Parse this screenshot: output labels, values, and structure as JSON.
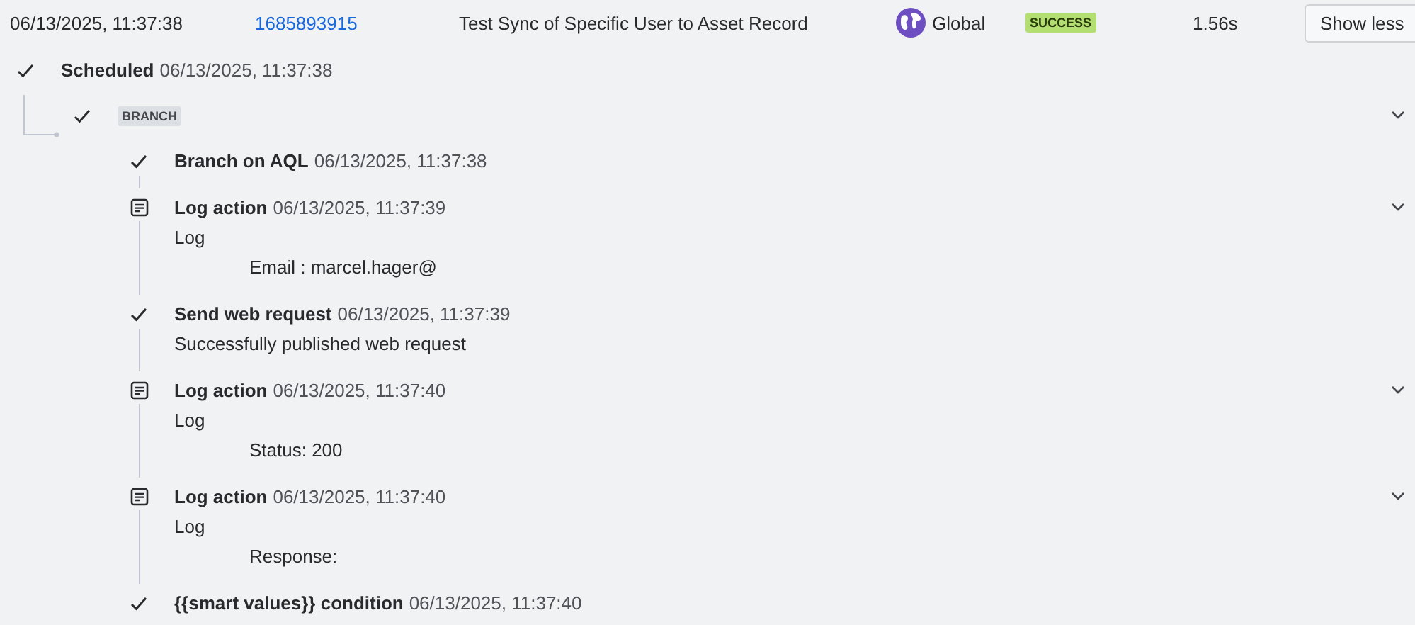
{
  "run": {
    "time": "06/13/2025, 11:37:38",
    "id": "1685893915",
    "rule": "Test Sync of Specific User to Asset Record",
    "scope": "Global",
    "status": "SUCCESS",
    "duration": "1.56s",
    "button": "Show less"
  },
  "steps": [
    {
      "kind": "check",
      "title": "Scheduled",
      "time": "06/13/2025, 11:37:38",
      "expandable": false,
      "children": [
        {
          "kind": "check",
          "badge": "BRANCH",
          "expandable": true,
          "children": [
            {
              "kind": "check",
              "title": "Branch on AQL",
              "time": "06/13/2025, 11:37:38",
              "expandable": false
            },
            {
              "kind": "log",
              "title": "Log action",
              "time": "06/13/2025, 11:37:39",
              "expandable": true,
              "lines": [
                {
                  "text": "Log",
                  "indented": false
                },
                {
                  "text": "Email : marcel.hager@",
                  "indented": true
                }
              ]
            },
            {
              "kind": "check",
              "title": "Send web request",
              "time": "06/13/2025, 11:37:39",
              "expandable": false,
              "lines": [
                {
                  "text": "Successfully published web request",
                  "indented": false
                }
              ]
            },
            {
              "kind": "log",
              "title": "Log action",
              "time": "06/13/2025, 11:37:40",
              "expandable": true,
              "lines": [
                {
                  "text": "Log",
                  "indented": false
                },
                {
                  "text": "Status: 200",
                  "indented": true
                }
              ]
            },
            {
              "kind": "log",
              "title": "Log action",
              "time": "06/13/2025, 11:37:40",
              "expandable": true,
              "lines": [
                {
                  "text": "Log",
                  "indented": false
                },
                {
                  "text": "Response:",
                  "indented": true
                }
              ]
            },
            {
              "kind": "check",
              "title": "{{smart values}} condition",
              "time": "06/13/2025, 11:37:40",
              "expandable": false
            }
          ]
        }
      ]
    }
  ]
}
